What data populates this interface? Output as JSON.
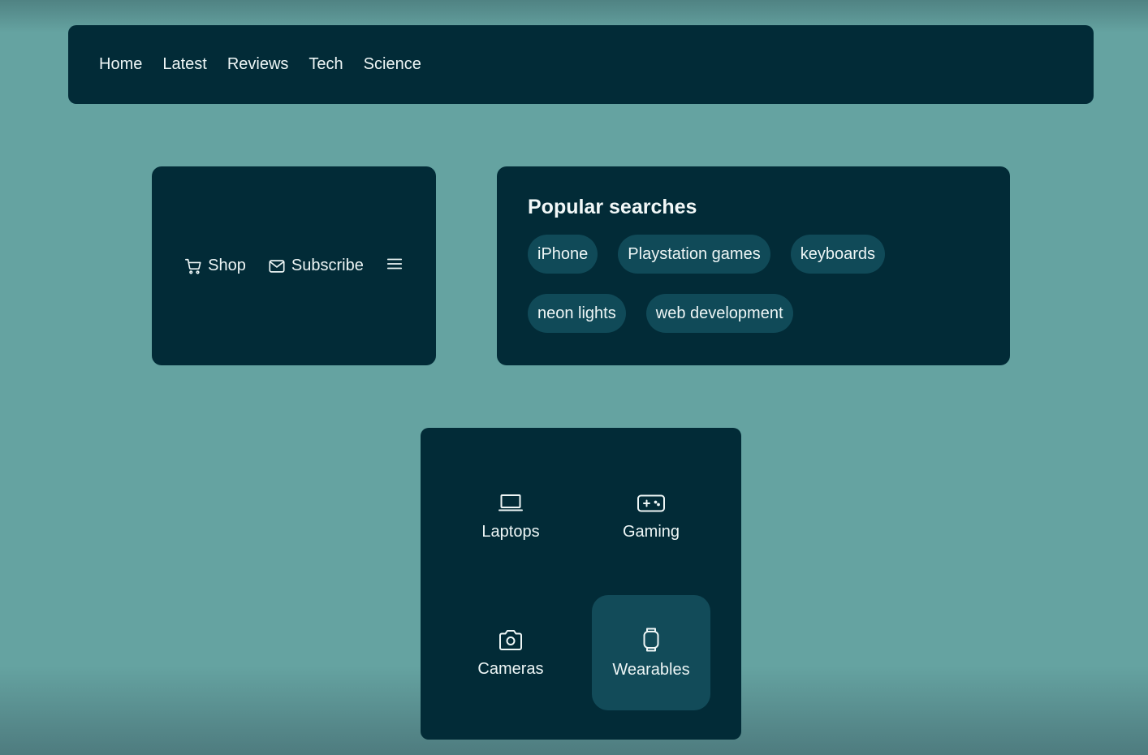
{
  "nav": {
    "items": [
      {
        "label": "Home"
      },
      {
        "label": "Latest"
      },
      {
        "label": "Reviews"
      },
      {
        "label": "Tech"
      },
      {
        "label": "Science"
      }
    ]
  },
  "actions": {
    "shop": {
      "label": "Shop",
      "icon": "cart-icon"
    },
    "subscribe": {
      "label": "Subscribe",
      "icon": "mail-icon"
    },
    "menu": {
      "icon": "hamburger-menu-icon"
    }
  },
  "popular": {
    "title": "Popular searches",
    "chips": [
      {
        "label": "iPhone"
      },
      {
        "label": "Playstation games"
      },
      {
        "label": "keyboards"
      },
      {
        "label": "neon lights"
      },
      {
        "label": "web development"
      }
    ]
  },
  "categories": {
    "items": [
      {
        "label": "Laptops",
        "icon": "laptop-icon",
        "active": false
      },
      {
        "label": "Gaming",
        "icon": "gamepad-icon",
        "active": false
      },
      {
        "label": "Cameras",
        "icon": "camera-icon",
        "active": false
      },
      {
        "label": "Wearables",
        "icon": "watch-icon",
        "active": true
      }
    ]
  },
  "colors": {
    "background": "#65a3a1",
    "panel": "#022b37",
    "chip": "#104a58",
    "active_tile": "#124b59",
    "text": "#eef6f6"
  }
}
